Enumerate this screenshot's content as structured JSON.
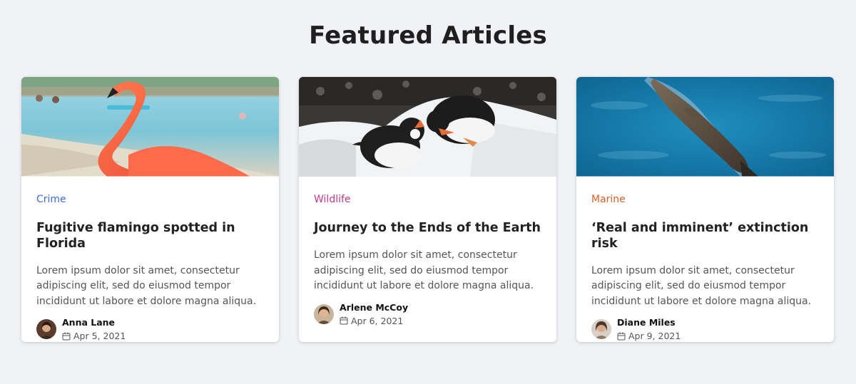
{
  "page": {
    "heading": "Featured Articles"
  },
  "articles": [
    {
      "category": "Crime",
      "category_color": "#3f6fd8",
      "title": "Fugitive flamingo spotted in Florida",
      "excerpt": "Lorem ipsum dolor sit amet, consectetur adipiscing elit, sed do eiusmod tempor incididunt ut labore et dolore magna aliqua.",
      "author": "Anna Lane",
      "date": "Apr 5, 2021",
      "image": "flamingo-beach-photo"
    },
    {
      "category": "Wildlife",
      "category_color": "#c2378a",
      "title": "Journey to the Ends of the Earth",
      "excerpt": "Lorem ipsum dolor sit amet, consectetur adipiscing elit, sed do eiusmod tempor incididunt ut labore et dolore magna aliqua.",
      "author": "Arlene McCoy",
      "date": "Apr 6, 2021",
      "image": "penguins-snow-photo"
    },
    {
      "category": "Marine",
      "category_color": "#d5622a",
      "title": "‘Real and imminent’ extinction risk",
      "excerpt": "Lorem ipsum dolor sit amet, consectetur adipiscing elit, sed do eiusmod tempor incididunt ut labore et dolore magna aliqua.",
      "author": "Diane Miles",
      "date": "Apr 9, 2021",
      "image": "seal-ocean-photo"
    }
  ],
  "colors": {
    "background": "#f0f2f6",
    "card": "#ffffff",
    "excerpt_text": "#555555"
  }
}
